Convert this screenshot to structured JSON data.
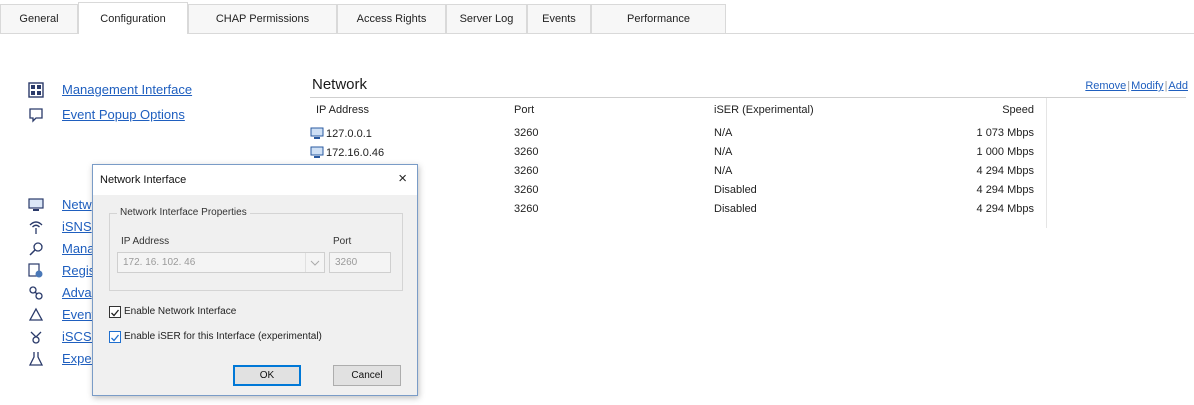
{
  "tabs": [
    {
      "label": "General",
      "active": false
    },
    {
      "label": "Configuration",
      "active": true
    },
    {
      "label": "CHAP Permissions",
      "active": false
    },
    {
      "label": "Access Rights",
      "active": false
    },
    {
      "label": "Server Log",
      "active": false
    },
    {
      "label": "Events",
      "active": false
    },
    {
      "label": "Performance",
      "active": false
    }
  ],
  "sidebar": {
    "top_items": [
      {
        "label": "Management Interface",
        "icon": "grid-icon"
      },
      {
        "label": "Event Popup Options",
        "icon": "popup-window-icon"
      }
    ],
    "items": [
      {
        "label": "Netw",
        "icon": "network-monitor-icon"
      },
      {
        "label": "iSNS",
        "icon": "wireless-icon"
      },
      {
        "label": "Mana",
        "icon": "key-icon"
      },
      {
        "label": "Regis",
        "icon": "register-icon"
      },
      {
        "label": "Adva",
        "icon": "advanced-icon"
      },
      {
        "label": "Event",
        "icon": "bell-icon"
      },
      {
        "label": "iSCSI",
        "icon": "iscsi-icon"
      },
      {
        "label": "Exper",
        "icon": "flask-icon"
      }
    ]
  },
  "network": {
    "title": "Network",
    "actions": {
      "remove": "Remove",
      "modify": "Modify",
      "add": "Add"
    },
    "columns": {
      "ip": "IP Address",
      "port": "Port",
      "iser": "iSER (Experimental)",
      "speed": "Speed"
    },
    "rows": [
      {
        "ip": "127.0.0.1",
        "port": "3260",
        "iser": "N/A",
        "speed": "1 073 Mbps"
      },
      {
        "ip": "172.16.0.46",
        "port": "3260",
        "iser": "N/A",
        "speed": "1 000 Mbps"
      },
      {
        "ip": "",
        "port": "3260",
        "iser": "N/A",
        "speed": "4 294 Mbps"
      },
      {
        "ip": "",
        "port": "3260",
        "iser": "Disabled",
        "speed": "4 294 Mbps"
      },
      {
        "ip": "",
        "port": "3260",
        "iser": "Disabled",
        "speed": "4 294 Mbps"
      }
    ]
  },
  "dialog": {
    "title": "Network Interface",
    "close": "×",
    "group_title": "Network Interface Properties",
    "ip_label": "IP Address",
    "port_label": "Port",
    "ip_value": "172. 16. 102. 46",
    "port_value": "3260",
    "enable_label": "Enable Network Interface",
    "iser_label": "Enable iSER for this Interface (experimental)",
    "ok": "OK",
    "cancel": "Cancel"
  },
  "colors": {
    "link": "#1f5fbf",
    "accent": "#0078d7"
  }
}
